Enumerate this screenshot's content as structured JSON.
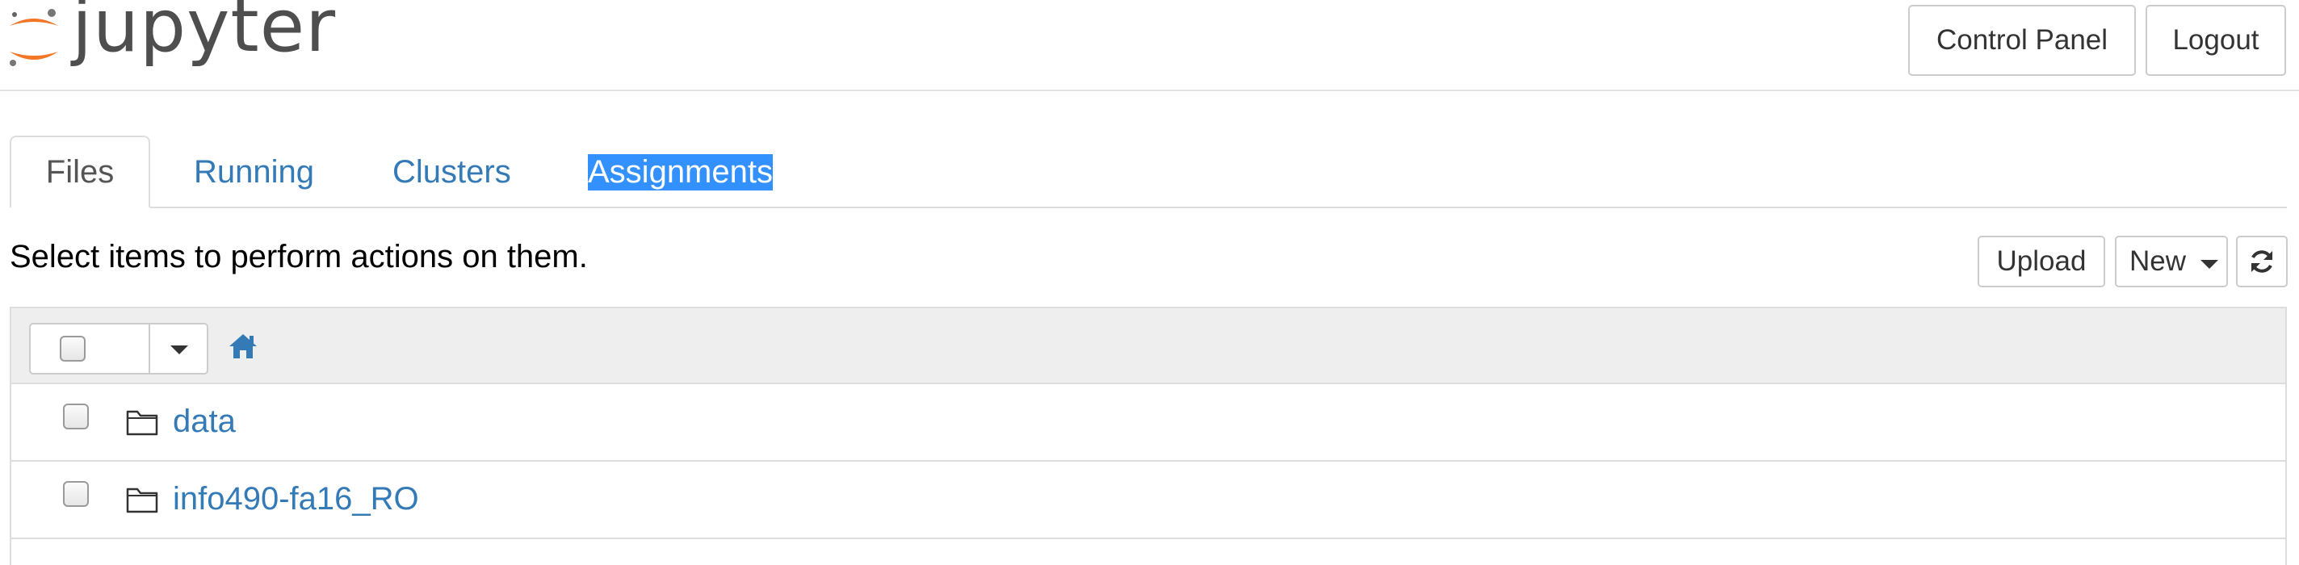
{
  "header": {
    "logo_text": "jupyter",
    "control_panel_label": "Control Panel",
    "logout_label": "Logout",
    "logo_colors": {
      "orange": "#f37626",
      "gray": "#767677"
    }
  },
  "tabs": [
    {
      "label": "Files",
      "active": true
    },
    {
      "label": "Running",
      "active": false
    },
    {
      "label": "Clusters",
      "active": false
    },
    {
      "label": "Assignments",
      "active": false,
      "highlighted": true
    }
  ],
  "toolbar": {
    "hint": "Select items to perform actions on them.",
    "upload_label": "Upload",
    "new_label": "New",
    "refresh_icon": "refresh-icon"
  },
  "file_list": {
    "home_icon": "home-icon",
    "items": [
      {
        "name": "data",
        "type": "folder"
      },
      {
        "name": "info490-fa16_RO",
        "type": "folder"
      }
    ]
  },
  "colors": {
    "link": "#337ab7",
    "selection_highlight": "#3390ff",
    "list_header_bg": "#eeeeee"
  }
}
